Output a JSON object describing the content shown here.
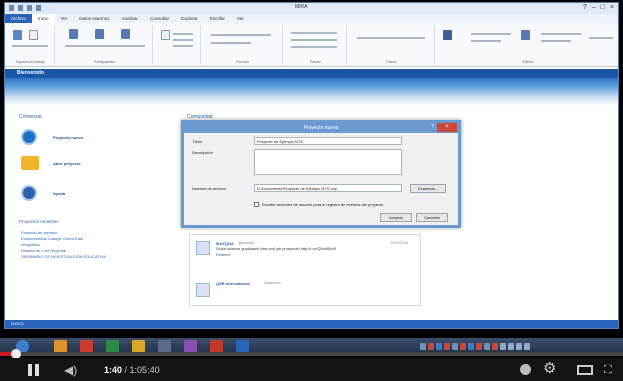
{
  "window": {
    "title": "MIRA"
  },
  "ribbon": {
    "tabs": [
      "Archivo",
      "Inicio",
      "Ver",
      "Datos externos",
      "Analizar",
      "Consultar",
      "Explorar",
      "Escribir",
      "Ver"
    ],
    "groups": [
      {
        "label": "Espacio de trabajo"
      },
      {
        "label": "Portapapeles"
      },
      {
        "label": "Formato"
      },
      {
        "label": "Párrafo"
      },
      {
        "label": "Estilos"
      },
      {
        "label": "Edición"
      }
    ]
  },
  "welcome": {
    "title": "Bienvenido"
  },
  "start": {
    "section_title": "Comenzar",
    "actions": [
      {
        "label": "Proyecto nuevo",
        "icon": "new-project-icon",
        "color": "#1f6fc2"
      },
      {
        "label": "Abrir proyecto",
        "icon": "folder-icon",
        "color": "#f0b429"
      },
      {
        "label": "Ayuda",
        "icon": "help-icon",
        "color": "#2b62ad"
      }
    ],
    "recent_title": "Proyectos recientes",
    "recent": [
      "Proyecto de ejemplo",
      "Environmental Change Green East",
      "Infográfica",
      "Historia de Lord Regional",
      "SEMINARIO DE INVESTIGACIÓN EDUCATIVA"
    ]
  },
  "community": {
    "title": "Comunidad"
  },
  "feed": {
    "posts": [
      {
        "name": "MAXQDA",
        "handle": "@maxqda",
        "date": "20/10/2015",
        "text": "Social science graduates! New tool job prospects! http://t.co/Q5m8EpW",
        "link": "Retweet"
      },
      {
        "name": "QSR International",
        "handle": "@qsrnvivo",
        "date": "",
        "text": "",
        "link": ""
      }
    ]
  },
  "dialog": {
    "title": "Proyecto nuevo",
    "help": "?",
    "title_label": "Título",
    "title_value": "Proyecto de Ejemplo NTS",
    "description_label": "Descripción",
    "description_value": "",
    "filename_label": "Nombre de archivo",
    "filename_value": "D:\\Documents\\Proyecto de Ejemplo NTS.nvp",
    "browse_label": "Examinar...",
    "checkbox_label": "Escribir acciones de usuario para el registro de eventos del proyecto",
    "checkbox_checked": false,
    "accept_label": "Aceptar",
    "cancel_label": "Cancelar"
  },
  "status": {
    "text": "NVIVO"
  },
  "video": {
    "current_time": "1:40",
    "duration": "1:05:40",
    "progress_fraction": 0.025,
    "accent_color": "#cc181e"
  }
}
